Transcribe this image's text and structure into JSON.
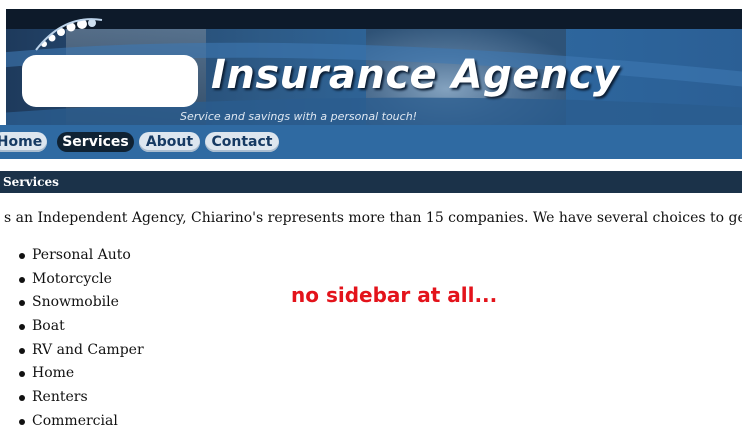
{
  "header": {
    "title": "Insurance Agency",
    "tagline": "Service and savings with a personal touch!"
  },
  "nav": {
    "items": [
      {
        "label": "Home"
      },
      {
        "label": "Services"
      },
      {
        "label": "About"
      },
      {
        "label": "Contact"
      }
    ],
    "active": "Services"
  },
  "section": {
    "title": "Services"
  },
  "content": {
    "intro": "s an Independent Agency, Chiarino's represents more than 15 companies.  We have several choices to get you the be",
    "services": [
      "Personal Auto",
      "Motorcycle",
      "Snowmobile",
      "Boat",
      "RV and Camper",
      "Home",
      "Renters",
      "Commercial"
    ]
  },
  "annotation": "no sidebar at all...",
  "colors": {
    "banner": "#2f6aa2",
    "nav_active": "#0f2233",
    "section_bar": "#1b3249",
    "annotation": "#e3131b"
  }
}
